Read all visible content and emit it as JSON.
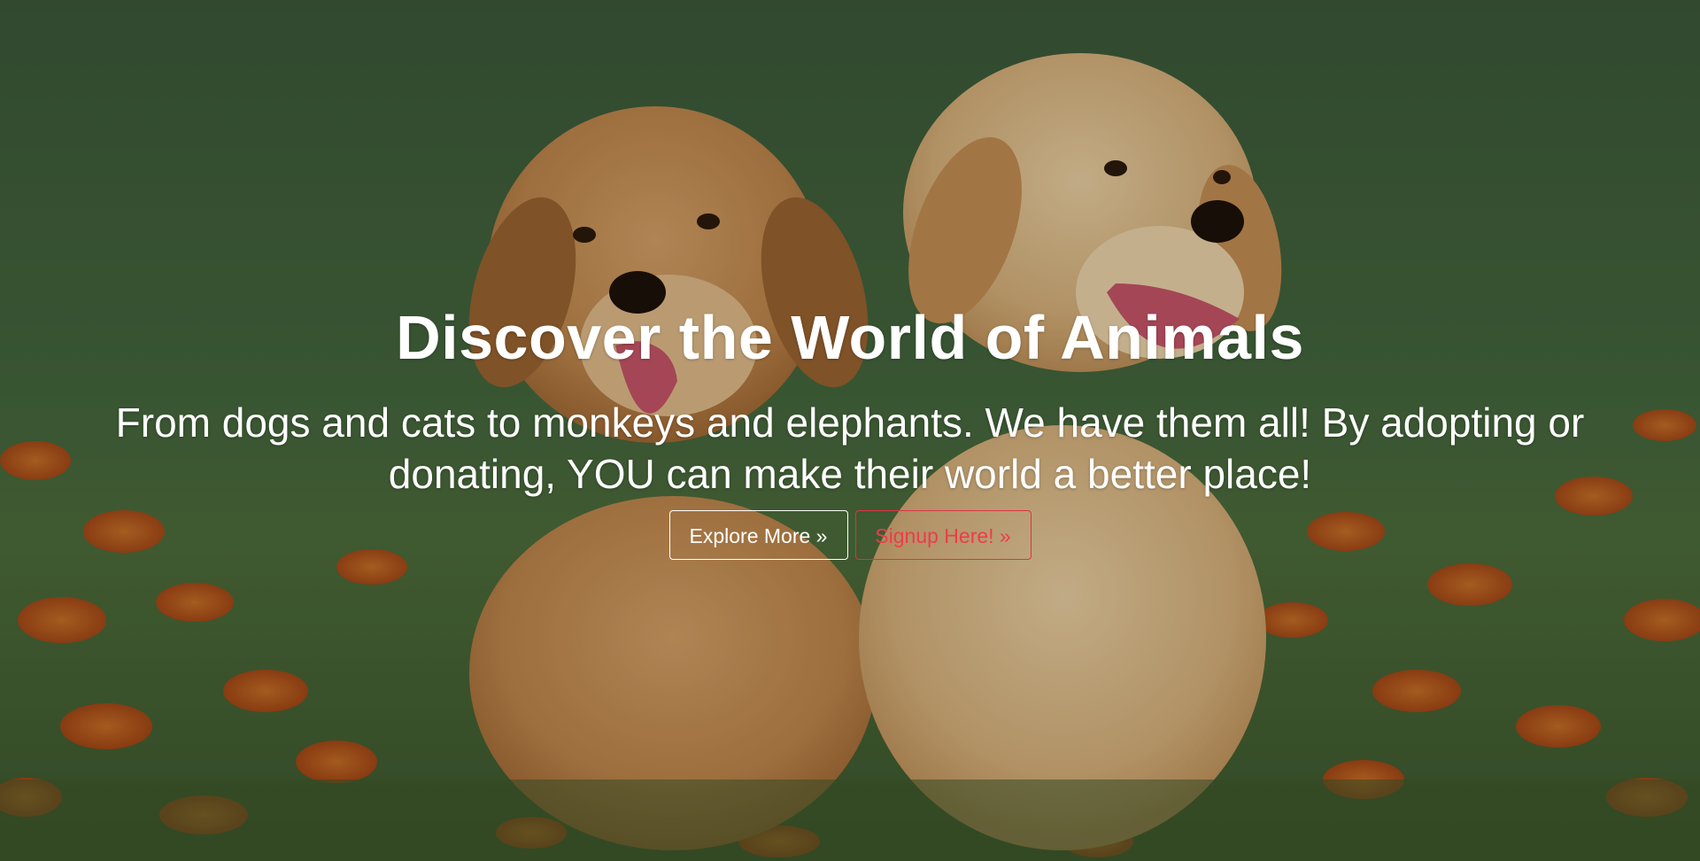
{
  "hero": {
    "title": "Discover the World of Animals",
    "subtitle": "From dogs and cats to monkeys and elephants. We have them all! By adopting or donating, YOU can make their world a better place!",
    "explore_label": "Explore More »",
    "signup_label": "Signup Here! »"
  },
  "colors": {
    "text": "#ffffff",
    "signup_accent": "#dc3545",
    "grass": "#4a6b3c",
    "flowers": "#d9621f",
    "puppy_fur": "#e2b27a"
  },
  "background": {
    "subject_icon": "two-puppies-in-grass-photo"
  }
}
